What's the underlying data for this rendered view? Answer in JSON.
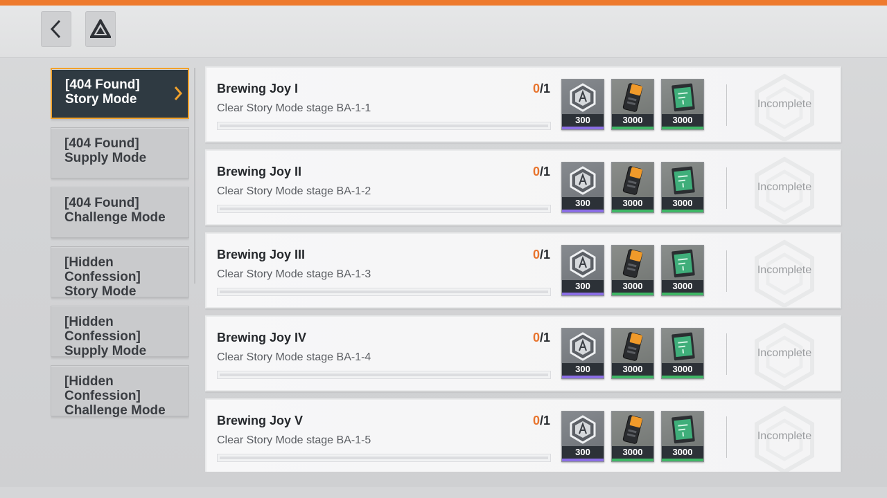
{
  "header": {
    "back_icon": "chevron-left-icon",
    "home_icon": "logo-triangle-icon"
  },
  "sidebar": {
    "items": [
      {
        "label": "[404 Found] Story Mode",
        "active": true
      },
      {
        "label": "[404 Found] Supply Mode",
        "active": false
      },
      {
        "label": "[404 Found] Challenge Mode",
        "active": false
      },
      {
        "label": "[Hidden Confession] Story Mode",
        "active": false
      },
      {
        "label": "[Hidden Confession] Supply Mode",
        "active": false
      },
      {
        "label": "[Hidden Confession] Challenge Mode",
        "active": false
      }
    ]
  },
  "quests": [
    {
      "title": "Brewing Joy I",
      "desc": "Clear Story Mode stage BA-1-1",
      "current": "0",
      "total": "1",
      "progress": 0,
      "status": "Incomplete",
      "rewards": [
        {
          "icon": "emblem-token-icon",
          "amount": "300"
        },
        {
          "icon": "orange-battery-icon",
          "amount": "3000"
        },
        {
          "icon": "green-card-icon",
          "amount": "3000"
        }
      ]
    },
    {
      "title": "Brewing Joy II",
      "desc": "Clear Story Mode stage BA-1-2",
      "current": "0",
      "total": "1",
      "progress": 0,
      "status": "Incomplete",
      "rewards": [
        {
          "icon": "emblem-token-icon",
          "amount": "300"
        },
        {
          "icon": "orange-battery-icon",
          "amount": "3000"
        },
        {
          "icon": "green-card-icon",
          "amount": "3000"
        }
      ]
    },
    {
      "title": "Brewing Joy III",
      "desc": "Clear Story Mode stage BA-1-3",
      "current": "0",
      "total": "1",
      "progress": 0,
      "status": "Incomplete",
      "rewards": [
        {
          "icon": "emblem-token-icon",
          "amount": "300"
        },
        {
          "icon": "orange-battery-icon",
          "amount": "3000"
        },
        {
          "icon": "green-card-icon",
          "amount": "3000"
        }
      ]
    },
    {
      "title": "Brewing Joy IV",
      "desc": "Clear Story Mode stage BA-1-4",
      "current": "0",
      "total": "1",
      "progress": 0,
      "status": "Incomplete",
      "rewards": [
        {
          "icon": "emblem-token-icon",
          "amount": "300"
        },
        {
          "icon": "orange-battery-icon",
          "amount": "3000"
        },
        {
          "icon": "green-card-icon",
          "amount": "3000"
        }
      ]
    },
    {
      "title": "Brewing Joy V",
      "desc": "Clear Story Mode stage BA-1-5",
      "current": "0",
      "total": "1",
      "progress": 0,
      "status": "Incomplete",
      "rewards": [
        {
          "icon": "emblem-token-icon",
          "amount": "300"
        },
        {
          "icon": "orange-battery-icon",
          "amount": "3000"
        },
        {
          "icon": "green-card-icon",
          "amount": "3000"
        }
      ]
    }
  ],
  "colors": {
    "accent_orange": "#e8742d",
    "active_border": "#f2a22c",
    "active_bg": "#2f3a42",
    "rarity_purple": "#8b6ee6",
    "rarity_green": "#3fb765",
    "top_stripe": "#ee7a2e"
  }
}
